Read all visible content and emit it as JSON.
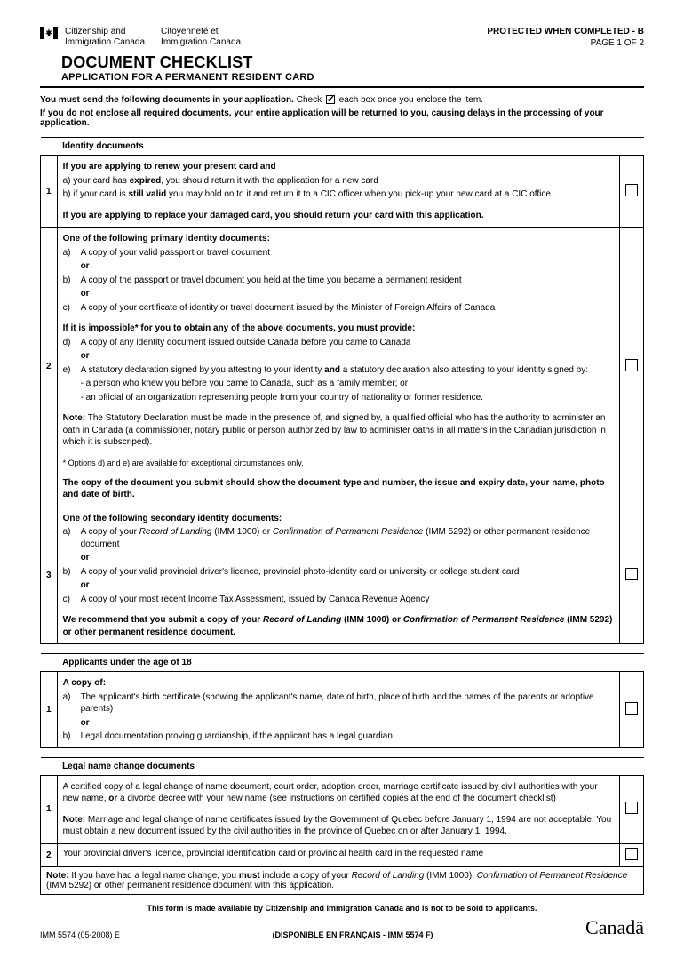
{
  "header": {
    "dept_en_1": "Citizenship and",
    "dept_en_2": "Immigration Canada",
    "dept_fr_1": "Citoyenneté et",
    "dept_fr_2": "Immigration Canada",
    "protected": "PROTECTED WHEN COMPLETED - B",
    "page": "PAGE 1 OF 2",
    "title": "DOCUMENT CHECKLIST",
    "subtitle": "APPLICATION FOR A PERMANENT RESIDENT CARD"
  },
  "instructions": {
    "line1_a": "You must send the following documents in your application.",
    "line1_b": "Check",
    "line1_c": "each box once you enclose the item.",
    "line2": "If you do not enclose all required documents, your entire application will be returned to you, causing delays in the processing of your application."
  },
  "sections": {
    "identity": {
      "title": "Identity documents",
      "items": {
        "1": {
          "intro": "If you are applying to renew your present card and",
          "a_pre": "a) your card has ",
          "a_bold": "expired",
          "a_post": ", you should return it with the application for a new card",
          "b_pre": "b) if your card is ",
          "b_bold": "still valid",
          "b_post": " you may hold on to it and return it to a CIC officer when you pick-up your new card at a CIC office.",
          "replace": "If you are applying to replace your damaged card, you should return your card with this application."
        },
        "2": {
          "primary_title": "One of the following primary identity documents:",
          "a": "A copy of your valid passport or travel document",
          "b": "A copy of the passport or travel document you held at the time you became a permanent resident",
          "c": "A copy of your certificate of identity or travel document issued by the Minister of Foreign Affairs of Canada",
          "impossible": "If it is impossible* for you to obtain any of the above documents, you must provide:",
          "d": "A copy of any identity document issued outside Canada before you came to Canada",
          "e_pre": "A statutory declaration signed by you attesting to your identity ",
          "e_bold": "and",
          "e_post": " a statutory declaration also attesting to your identity signed by:",
          "e_sub1": "- a person who knew you before you came to Canada, such as a family member; or",
          "e_sub2": "- an official of an organization representing people from your country of nationality or former residence.",
          "note_label": "Note:",
          "note_text": " The Statutory Declaration must be made in the presence of, and signed by, a qualified official who has the authority to administer an oath in Canada (a commissioner, notary public or person authorized by law to administer oaths in all matters in the Canadian jurisdiction in which it is subscriped).",
          "options_note": "* Options d) and e) are available for exceptional circumstances only.",
          "copy_note": "The copy of the document you submit should show the document type and number, the issue and expiry date, your name, photo and date of birth.",
          "or": "or"
        },
        "3": {
          "secondary_title": "One of the following secondary identity documents:",
          "a_pre": "A copy of your ",
          "a_i1": "Record of Landing",
          "a_mid1": " (IMM 1000) or ",
          "a_i2": "Confirmation of Permanent Residence",
          "a_post": " (IMM 5292) or other permanent residence document",
          "b": "A copy of your valid provincial driver's licence, provincial photo-identity card or university or college student card",
          "c": "A copy of your most recent Income Tax Assessment, issued by Canada Revenue Agency",
          "rec_pre": "We recommend that you submit a copy of your ",
          "rec_i1": "Record of Landing",
          "rec_mid": " (IMM 1000) or ",
          "rec_i2": "Confirmation of Permanent Residence",
          "rec_post": " (IMM 5292) or other permanent residence document.",
          "or": "or"
        }
      }
    },
    "under18": {
      "title": "Applicants under the age of 18",
      "items": {
        "1": {
          "intro": "A copy of:",
          "a": "The applicant's birth certificate (showing the applicant's name, date of birth, place of birth and the names of the parents or adoptive parents)",
          "b": "Legal documentation proving guardianship, if the applicant has a legal guardian",
          "or": "or"
        }
      }
    },
    "legal": {
      "title": "Legal name change documents",
      "items": {
        "1": {
          "text_pre": "A certified copy of a legal change of name document, court order, adoption order, marriage certificate issued by civil authorities with your new name, ",
          "text_bold": "or",
          "text_post": " a divorce decree with your new name  (see instructions on certified copies at the end of the document checklist)",
          "note_label": "Note:",
          "note_text": " Marriage and legal change of name certificates issued by the Government of Quebec before January 1, 1994 are not acceptable. You must obtain a new document issued by the civil authorities in the province of Quebec on or after January 1, 1994."
        },
        "2": {
          "text": "Your provincial driver's licence, provincial identification card or provincial health card in the requested name"
        }
      },
      "bottom_note_label": "Note:",
      "bottom_note_pre": " If you have had a legal name change, you ",
      "bottom_note_bold": "must",
      "bottom_note_mid": " include a copy of your ",
      "bottom_note_i1": "Record of Landing",
      "bottom_note_mid2": " (IMM 1000), ",
      "bottom_note_i2": "Confirmation of Permanent Residence",
      "bottom_note_post": " (IMM 5292) or other permanent residence document with this application."
    }
  },
  "footer": {
    "line1": "This form is made available by Citizenship and Immigration Canada and is not to be sold to applicants.",
    "line2": "(DISPONIBLE EN FRANÇAIS - IMM 5574 F)",
    "form_num": "IMM 5574 (05-2008) E",
    "wordmark": "Canadä"
  }
}
